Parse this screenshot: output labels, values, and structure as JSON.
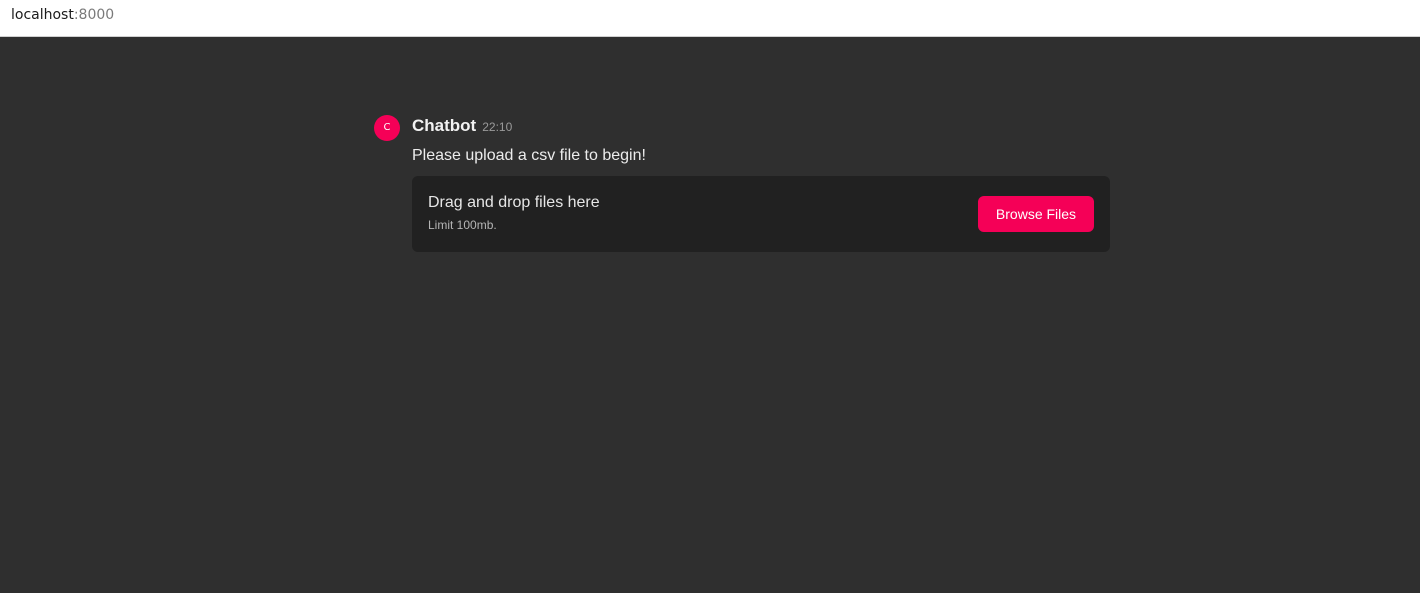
{
  "browser": {
    "host": "localhost",
    "port": ":8000"
  },
  "message": {
    "avatar_letter": "C",
    "author": "Chatbot",
    "time": "22:10",
    "text": "Please upload a csv file to begin!"
  },
  "upload": {
    "title": "Drag and drop files here",
    "limit": "Limit 100mb.",
    "button_label": "Browse Files"
  },
  "colors": {
    "accent": "#f50057",
    "background": "#2f2f2f",
    "dropzone": "#212121"
  }
}
